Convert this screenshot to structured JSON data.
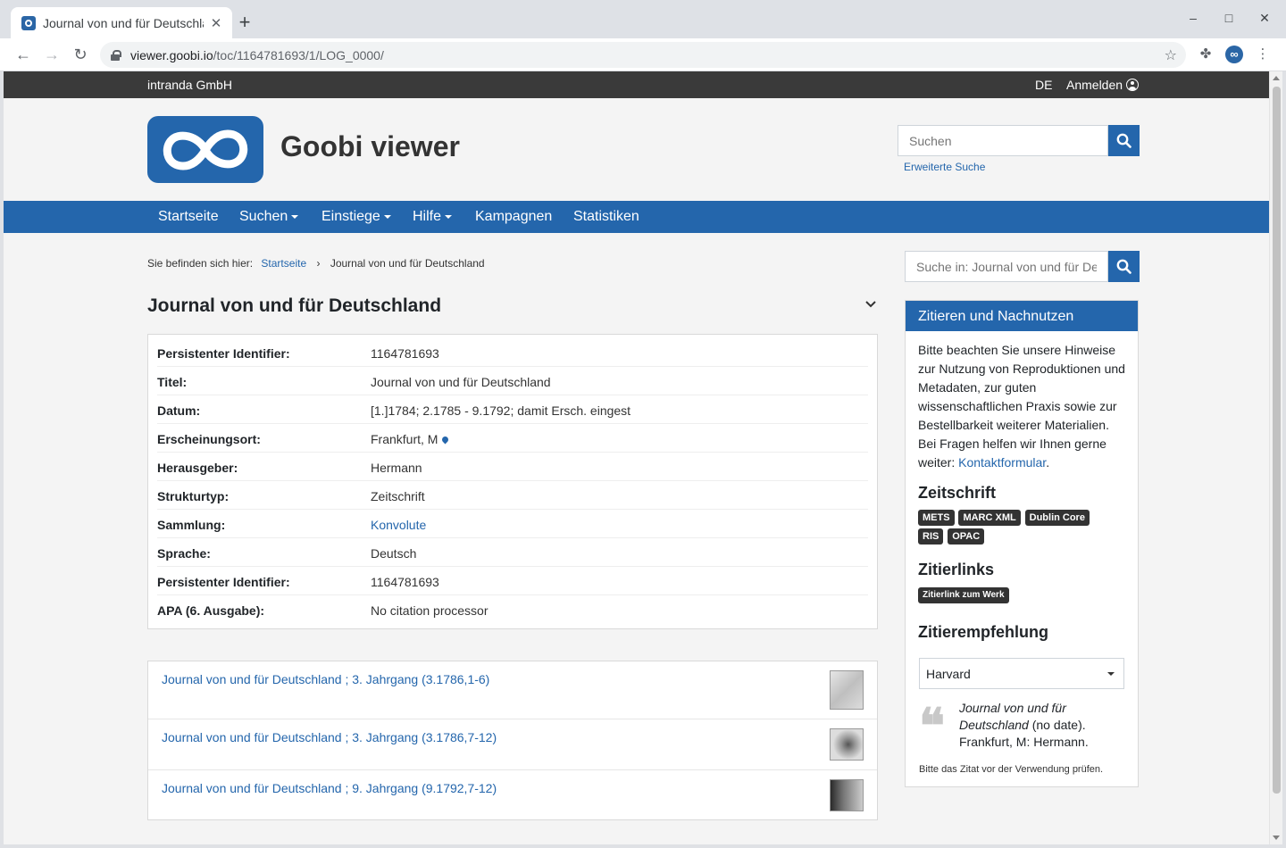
{
  "browser": {
    "tab_title": "Journal von und für Deutschland",
    "url_host": "viewer.goobi.io",
    "url_path": "/toc/1164781693/1/LOG_0000/"
  },
  "topbar": {
    "org": "intranda GmbH",
    "lang": "DE",
    "login": "Anmelden"
  },
  "header": {
    "site_title": "Goobi viewer",
    "search_placeholder": "Suchen",
    "advanced_search": "Erweiterte Suche"
  },
  "nav": {
    "items": [
      "Startseite",
      "Suchen",
      "Einstiege",
      "Hilfe",
      "Kampagnen",
      "Statistiken"
    ]
  },
  "breadcrumb": {
    "prefix": "Sie befinden sich hier:",
    "home": "Startseite",
    "separator": "›",
    "current": "Journal von und für Deutschland"
  },
  "record": {
    "title": "Journal von und für Deutschland",
    "metadata": [
      {
        "key": "Persistenter Identifier:",
        "value": "1164781693"
      },
      {
        "key": "Titel:",
        "value": "Journal von und für Deutschland"
      },
      {
        "key": "Datum:",
        "value": "[1.]1784; 2.1785 - 9.1792; damit Ersch. eingest"
      },
      {
        "key": "Erscheinungsort:",
        "value": "Frankfurt, M"
      },
      {
        "key": "Herausgeber:",
        "value": "Hermann"
      },
      {
        "key": "Strukturtyp:",
        "value": "Zeitschrift"
      },
      {
        "key": "Sammlung:",
        "value": "Konvolute"
      },
      {
        "key": "Sprache:",
        "value": "Deutsch"
      },
      {
        "key": "Persistenter Identifier:",
        "value": "1164781693"
      },
      {
        "key": "APA (6. Ausgabe):",
        "value": "No citation processor"
      }
    ],
    "volumes": [
      "Journal von und für Deutschland ; 3. Jahrgang (3.1786,1-6)",
      "Journal von und für Deutschland ; 3. Jahrgang (3.1786,7-12)",
      "Journal von und für Deutschland ; 9. Jahrgang (9.1792,7-12)"
    ]
  },
  "sidebar": {
    "search_placeholder": "Suche in: Journal von und für Deutschland",
    "widget_title": "Zitieren und Nachnutzen",
    "notice": "Bitte beachten Sie unsere Hinweise zur Nutzung von Reproduktionen und Metadaten, zur guten wissenschaftlichen Praxis sowie zur Bestellbarkeit weiterer Materialien. Bei Fragen helfen wir Ihnen gerne weiter: ",
    "contact_link": "Kontaktformular",
    "notice_end": ".",
    "section_format": "Zeitschrift",
    "formats": [
      "METS",
      "MARC XML",
      "Dublin Core",
      "RIS",
      "OPAC"
    ],
    "section_links": "Zitierlinks",
    "cite_link": "Zitierlink zum Werk",
    "section_recommend": "Zitierempfehlung",
    "style_selected": "Harvard",
    "citation_title": "Journal von und für Deutschland",
    "citation_rest": " (no date). Frankfurt, M: Hermann.",
    "cite_note": "Bitte das Zitat vor der Verwendung prüfen."
  },
  "colors": {
    "brand": "#2466ac",
    "topbar": "#3a3a3a"
  }
}
